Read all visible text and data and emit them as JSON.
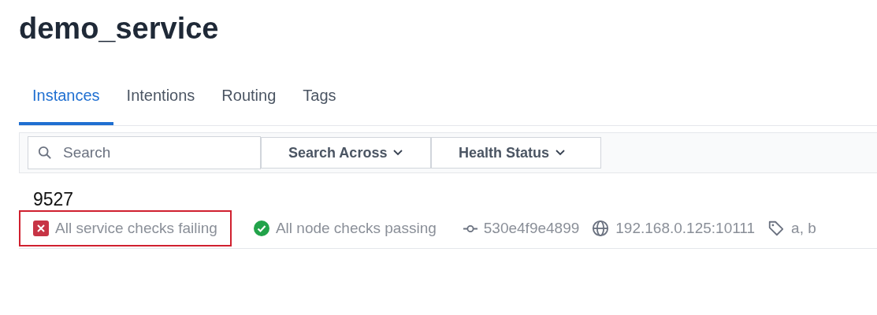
{
  "page_title": "demo_service",
  "tabs": [
    {
      "label": "Instances",
      "selected": true
    },
    {
      "label": "Intentions",
      "selected": false
    },
    {
      "label": "Routing",
      "selected": false
    },
    {
      "label": "Tags",
      "selected": false
    }
  ],
  "toolbar": {
    "search": {
      "placeholder": "Search"
    },
    "filters": [
      "Search Across",
      "Health Status"
    ]
  },
  "instance": {
    "name": "9527",
    "checks": [
      {
        "label": "All service checks failing",
        "passing": false,
        "highlighted": true
      },
      {
        "label": "All node checks passing",
        "passing": true,
        "highlighted": false
      }
    ],
    "node_id": "530e4f9e4899",
    "address": "192.168.0.125:10111",
    "tags": "a, b"
  }
}
